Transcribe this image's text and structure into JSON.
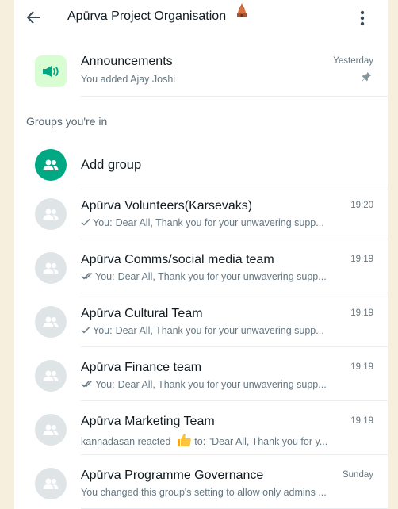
{
  "header": {
    "title": "Apūrva Project Organisation"
  },
  "announcements": {
    "name": "Announcements",
    "subtitle": "You added Ajay Joshi",
    "time": "Yesterday"
  },
  "section_label": "Groups you're in",
  "add_group_label": "Add group",
  "groups": [
    {
      "name": "Apūrva Volunteers(Karsevaks)",
      "time": "19:20",
      "tick": "single",
      "prefix": "You:",
      "text": "Dear All, Thank you for your unwavering supp..."
    },
    {
      "name": "Apūrva Comms/social media team",
      "time": "19:19",
      "tick": "double",
      "prefix": "You:",
      "text": "Dear All, Thank you for your unwavering supp..."
    },
    {
      "name": "Apūrva Cultural Team",
      "time": "19:19",
      "tick": "single",
      "prefix": "You:",
      "text": "Dear All, Thank you for your unwavering supp..."
    },
    {
      "name": "Apūrva Finance team",
      "time": "19:19",
      "tick": "double",
      "prefix": "You:",
      "text": "Dear All, Thank you for your unwavering supp..."
    },
    {
      "name": "Apūrva Marketing Team",
      "time": "19:19",
      "tick": "none",
      "prefix": "kannadasan reacted",
      "text": "to: \"Dear All, Thank you for y..."
    },
    {
      "name": "Apūrva Programme Governance",
      "time": "Sunday",
      "tick": "none",
      "prefix": "",
      "text": "You changed this group's setting to allow only admins ..."
    }
  ],
  "colors": {
    "accent_green": "#00a884",
    "page_bg": "#f6efde",
    "muted_text": "#667781"
  }
}
